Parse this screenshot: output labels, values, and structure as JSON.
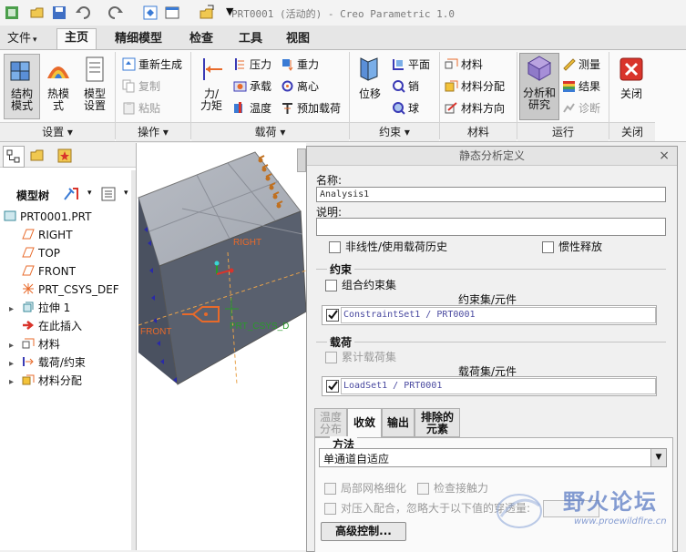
{
  "window": {
    "title": "PRT0001 (活动的) - Creo Parametric 1.0"
  },
  "tabs": [
    {
      "label": "文件",
      "dropdown": "▾"
    },
    {
      "label": "主页"
    },
    {
      "label": "精细模型"
    },
    {
      "label": "检查"
    },
    {
      "label": "工具"
    },
    {
      "label": "视图"
    }
  ],
  "ribbon": {
    "groups": {
      "settings": "设置",
      "operations": "操作",
      "loads": "载荷",
      "constraints": "约束",
      "material": "材料",
      "run": "运行",
      "close": "关闭"
    },
    "dropdown_arrow": "▾",
    "buttons": {
      "structure_mode": [
        "结构",
        "模式"
      ],
      "thermal_mode": [
        "热模",
        "式"
      ],
      "model_setup": [
        "模型",
        "设置"
      ],
      "regenerate": "重新生成",
      "copy": "复制",
      "paste": "粘贴",
      "force_moment": [
        "力/",
        "力矩"
      ],
      "pressure": "压力",
      "bearing": "承载",
      "temperature": "温度",
      "gravity": "重力",
      "centrifugal": "离心",
      "preload": "预加载荷",
      "displacement": "位移",
      "plane": "平面",
      "pin": "销",
      "ball": "球",
      "material": "材料",
      "material_assign": "材料分配",
      "material_orient": "材料方向",
      "analysis_study": [
        "分析和",
        "研究"
      ],
      "measure": "测量",
      "results": "结果",
      "diagnostics": "诊断",
      "close": "关闭"
    }
  },
  "colors": {
    "accent": "#3a7bd5",
    "red_close": "#d9342b",
    "active_run": "#c9c9c9"
  },
  "tree": {
    "header": "模型树",
    "items": [
      {
        "label": "PRT0001.PRT",
        "icon": "part-icon"
      },
      {
        "label": "RIGHT",
        "icon": "datum-plane-icon"
      },
      {
        "label": "TOP",
        "icon": "datum-plane-icon"
      },
      {
        "label": "FRONT",
        "icon": "datum-plane-icon"
      },
      {
        "label": "PRT_CSYS_DEF",
        "icon": "csys-icon"
      },
      {
        "label": "拉伸 1",
        "icon": "extrude-icon"
      },
      {
        "label": "在此插入",
        "icon": "insert-arrow-icon"
      },
      {
        "label": "材料",
        "icon": "material-icon"
      },
      {
        "label": "载荷/约束",
        "icon": "load-icon"
      },
      {
        "label": "材料分配",
        "icon": "material-assign-icon"
      }
    ],
    "expanders": [
      "▸"
    ]
  },
  "viewport": {
    "labels": {
      "right": "RIGHT",
      "front": "FRONT",
      "csys": "PRT_CSYS_D"
    }
  },
  "dialog": {
    "title": "静态分析定义",
    "close": "×",
    "name_label": "名称:",
    "name_value": "Analysis1",
    "desc_label": "说明:",
    "desc_value": "",
    "nonlinear": "非线性/使用载荷历史",
    "inertia_relief": "惯性释放",
    "constraints": {
      "title": "约束",
      "combine": "组合约束集",
      "col_header": "约束集/元件",
      "row": "ConstraintSet1 / PRT0001"
    },
    "loads": {
      "title": "载荷",
      "cumulative": "累计载荷集",
      "col_header": "载荷集/元件",
      "row": "LoadSet1 / PRT0001"
    },
    "tabs": [
      {
        "label": [
          "温度",
          "分布"
        ],
        "disabled": true
      },
      {
        "label": [
          "收敛"
        ],
        "active": true
      },
      {
        "label": [
          "输出"
        ]
      },
      {
        "label": [
          "排除的",
          "元素"
        ]
      }
    ],
    "method": {
      "title": "方法",
      "value": "单通道自适应"
    },
    "local_mesh": "局部网格细化",
    "check_contact": "检查接触力",
    "press_fit": "对压入配合，忽略大于以下值的穿透量:",
    "advanced": "高级控制...",
    "watermark_cn": "野火论坛",
    "watermark_url": "www.proewildfire.cn"
  }
}
